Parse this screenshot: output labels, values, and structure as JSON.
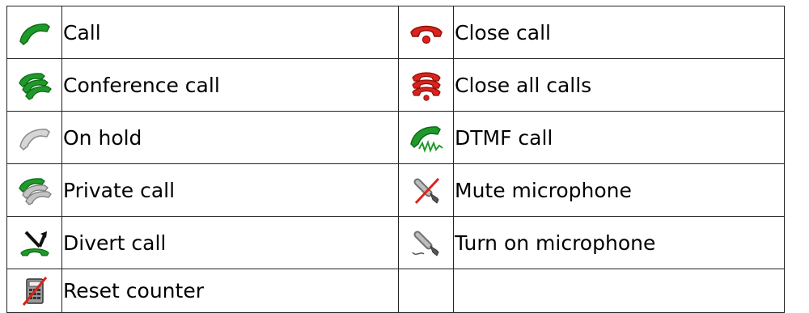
{
  "legend": {
    "rows": [
      {
        "left": {
          "icon": "green-handset-icon",
          "label": "Call"
        },
        "right": {
          "icon": "red-handset-hangup-icon",
          "label": "Close call"
        }
      },
      {
        "left": {
          "icon": "green-multiple-handsets-icon",
          "label": "Conference call"
        },
        "right": {
          "icon": "red-multiple-handsets-hangup-icon",
          "label": "Close all calls"
        }
      },
      {
        "left": {
          "icon": "grey-handset-icon",
          "label": "On hold"
        },
        "right": {
          "icon": "green-handset-dtmf-wave-icon",
          "label": "DTMF call"
        }
      },
      {
        "left": {
          "icon": "green-grey-handsets-icon",
          "label": "Private call"
        },
        "right": {
          "icon": "microphone-muted-icon",
          "label": "Mute microphone"
        }
      },
      {
        "left": {
          "icon": "divert-arrow-handset-icon",
          "label": "Divert call"
        },
        "right": {
          "icon": "microphone-icon",
          "label": "Turn on microphone"
        }
      },
      {
        "left": {
          "icon": "calculator-crossed-icon",
          "label": "Reset counter"
        },
        "right": {
          "icon": "",
          "label": ""
        }
      }
    ]
  },
  "colors": {
    "call_green": "#1f9a2a",
    "call_green_dark": "#0d6b16",
    "hangup_red": "#d8241c",
    "hangup_red_dark": "#8f0f0a",
    "hold_grey": "#b9b9b9",
    "hold_grey_dark": "#8a8a8a",
    "border": "#222222"
  }
}
